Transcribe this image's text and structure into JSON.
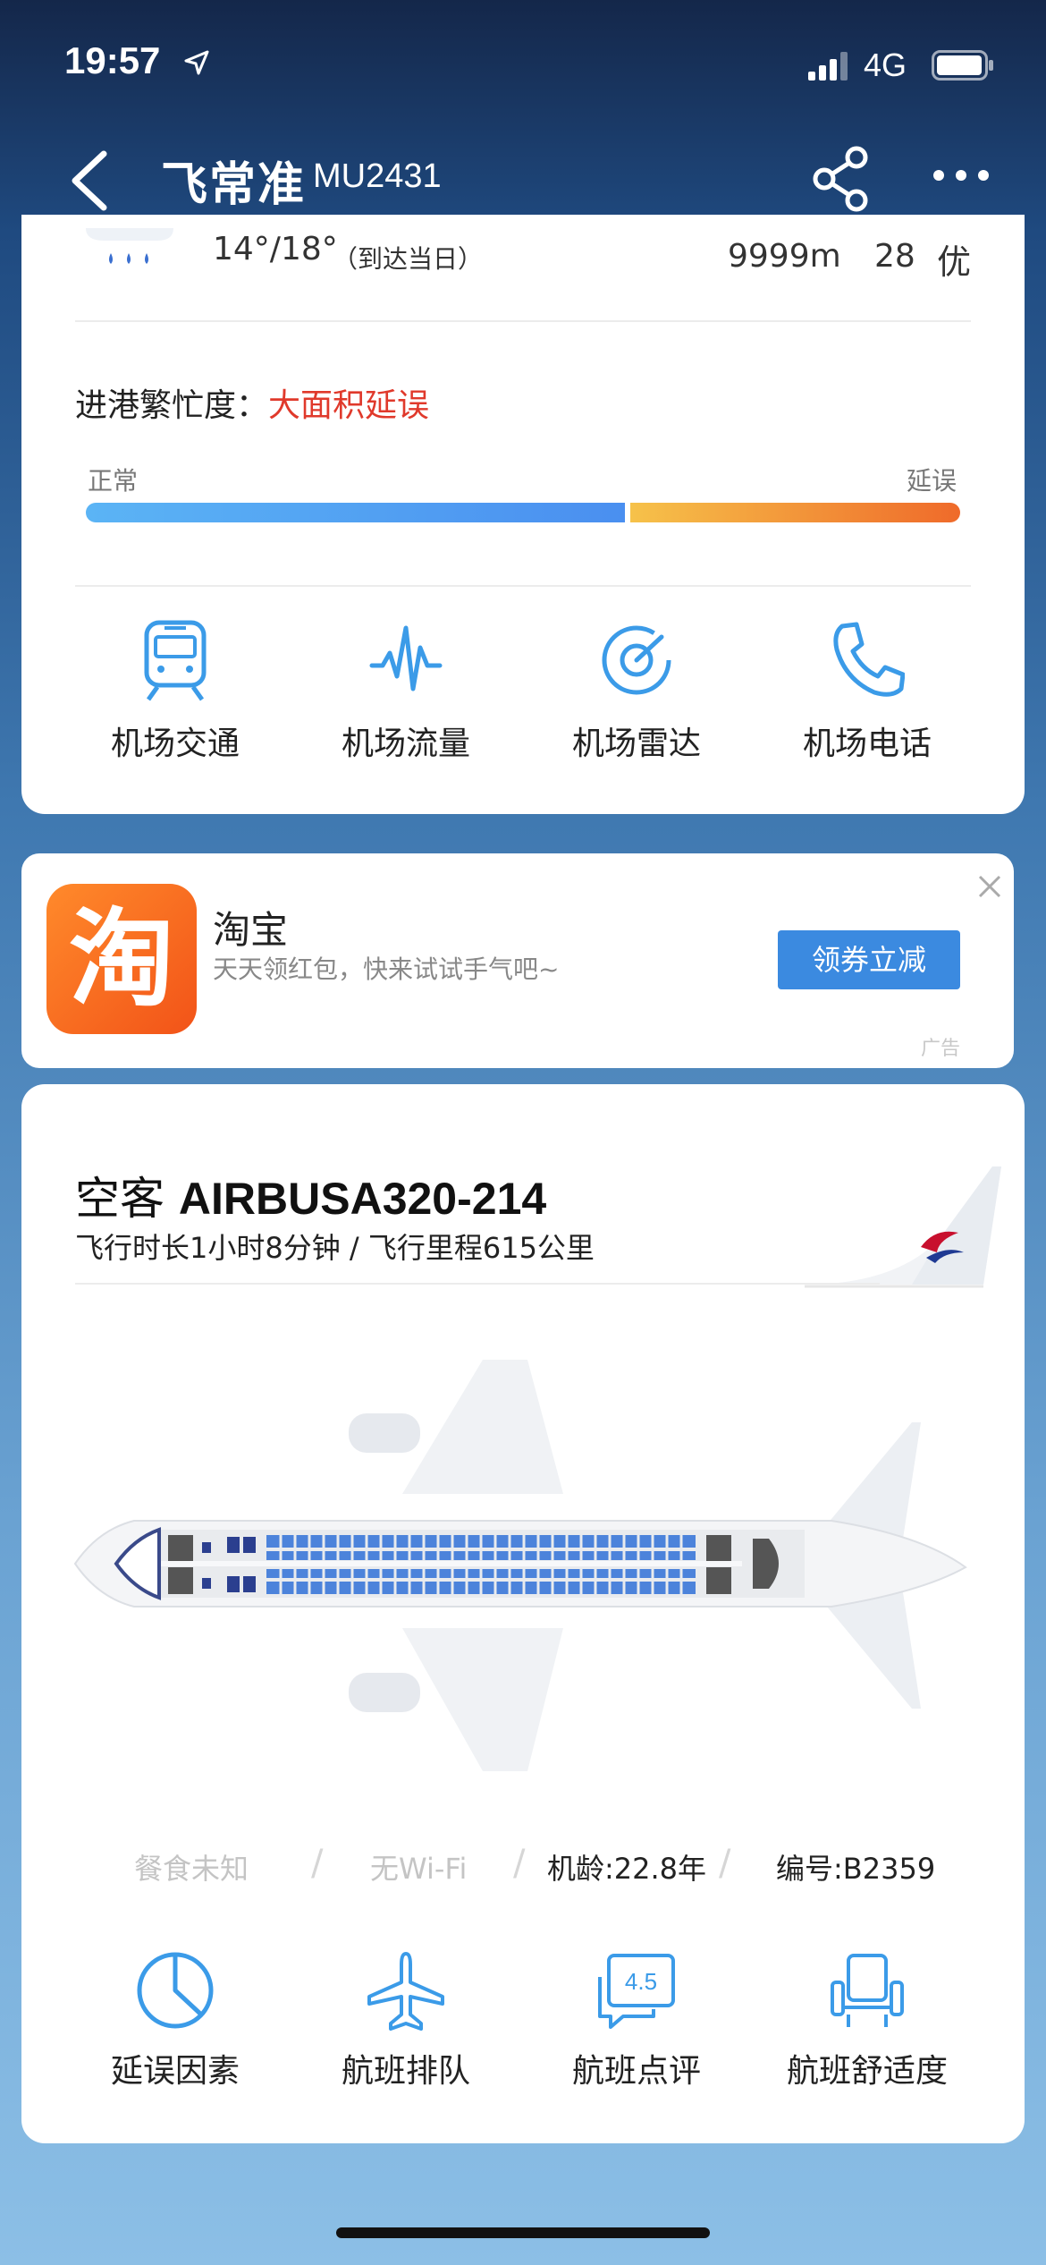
{
  "status_bar": {
    "time": "19:57",
    "network": "4G"
  },
  "nav": {
    "brand": "飞常准",
    "flight_no": "MU2431"
  },
  "weather": {
    "temp": "14°/18°",
    "temp_note": "（到达当日）",
    "visibility": "9999m",
    "aqi": "28",
    "aqi_level": "优"
  },
  "busyness": {
    "label": "进港繁忙度：",
    "value": "大面积延误",
    "scale_left": "正常",
    "scale_right": "延误",
    "normal_fraction": 0.62,
    "colors": {
      "value": "#e0392b",
      "normal": "#4a8ff0",
      "delay": "#ef6a2a"
    }
  },
  "airport_tools": [
    {
      "label": "机场交通",
      "icon": "train-icon"
    },
    {
      "label": "机场流量",
      "icon": "waveform-icon"
    },
    {
      "label": "机场雷达",
      "icon": "radar-icon"
    },
    {
      "label": "机场电话",
      "icon": "phone-icon"
    }
  ],
  "ad": {
    "logo_text": "淘",
    "title": "淘宝",
    "desc": "天天领红包，快来试试手气吧~",
    "button": "领券立减",
    "mark": "广告"
  },
  "aircraft": {
    "type_prefix": "空客",
    "model": "AIRBUSA320-214",
    "summary": "飞行时长1小时8分钟 / 飞行里程615公里",
    "info": [
      {
        "text": "餐食未知",
        "active": false
      },
      {
        "text": "无Wi-Fi",
        "active": false
      },
      {
        "text": "机龄:22.8年",
        "active": true
      },
      {
        "text": "编号:B2359",
        "active": true
      }
    ],
    "separator": "/"
  },
  "flight_tools": [
    {
      "label": "延误因素",
      "icon": "pie-chart-icon"
    },
    {
      "label": "航班排队",
      "icon": "airplane-icon"
    },
    {
      "label": "航班点评",
      "icon": "rating-bubble-icon",
      "badge": "4.5"
    },
    {
      "label": "航班舒适度",
      "icon": "seat-icon"
    }
  ],
  "theme": {
    "accent": "#3b9be8"
  }
}
